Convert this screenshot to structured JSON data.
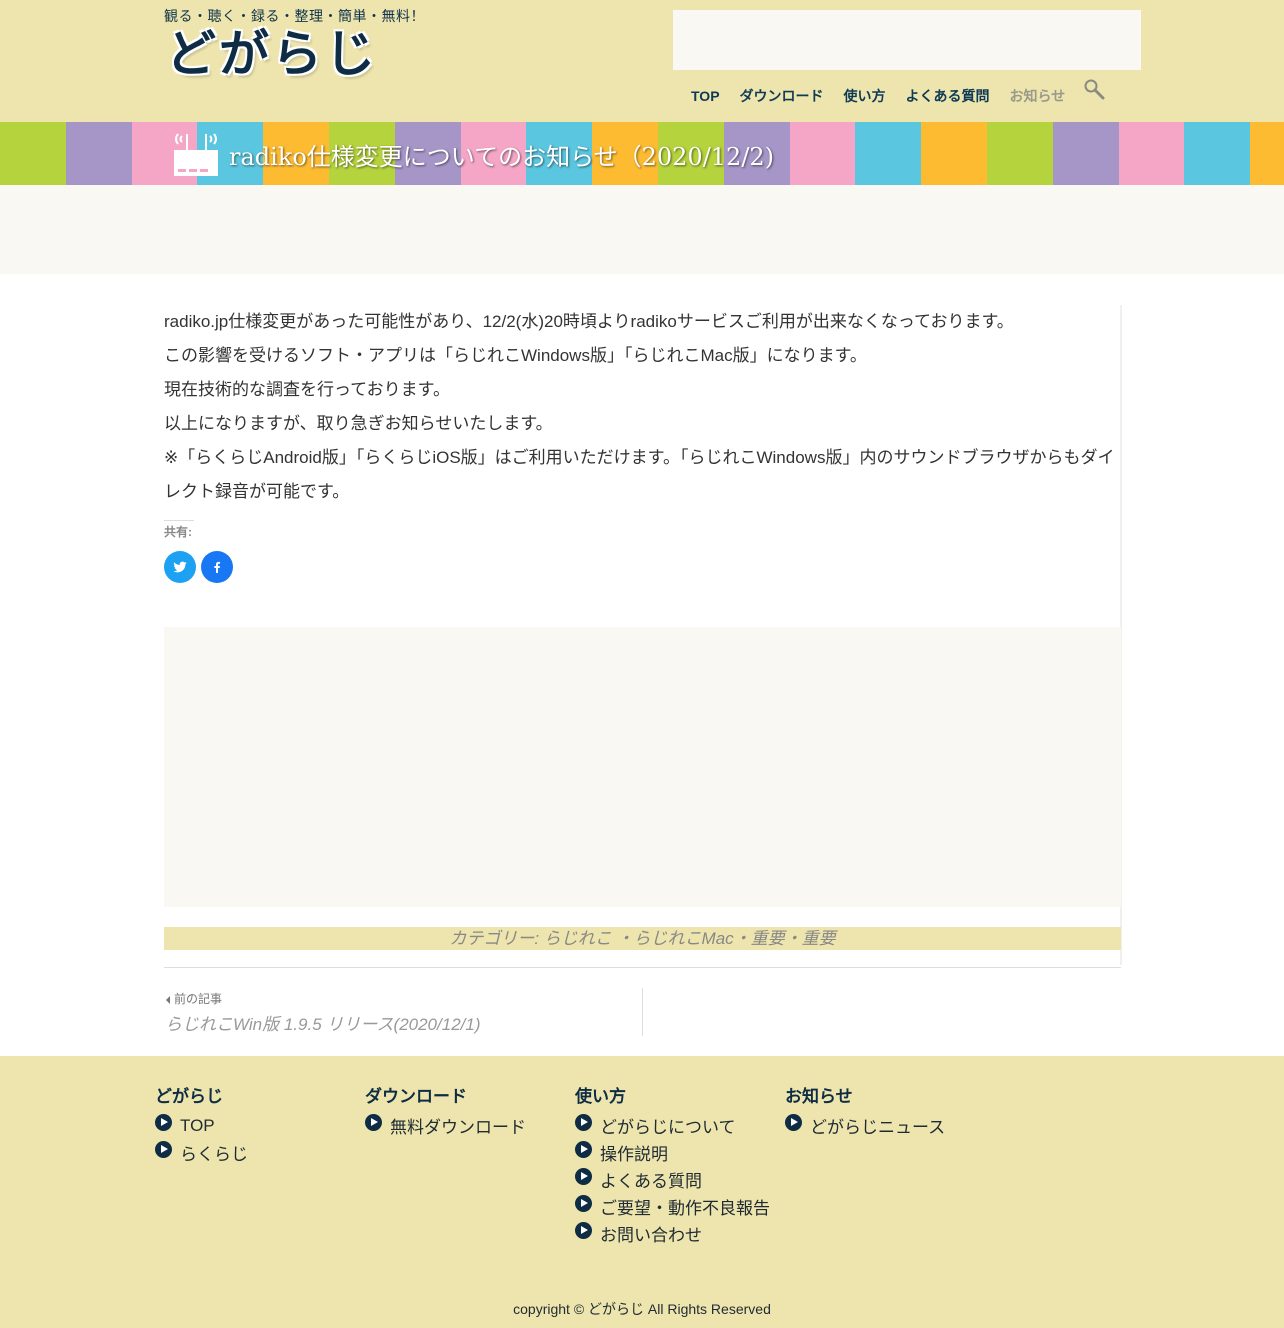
{
  "header": {
    "tagline": "観る・聴く・録る・整理・簡単・無料！",
    "logo_text": "どがらじ",
    "nav": [
      {
        "label": "TOP"
      },
      {
        "label": "ダウンロード"
      },
      {
        "label": "使い方"
      },
      {
        "label": "よくある質問"
      },
      {
        "label": "お知らせ"
      }
    ],
    "search_icon": "search-icon"
  },
  "banner": {
    "title": "radiko仕様変更についてのお知らせ（2020/12/2)",
    "icon": "radio-router-icon",
    "stripe_colors": [
      "#b5d33d",
      "#a696c8",
      "#f5a6c7",
      "#5bc6e0",
      "#fdbb32",
      "#b5d33d",
      "#a696c8",
      "#f5a6c7",
      "#5bc6e0",
      "#fdbb32",
      "#b5d33d",
      "#a696c8",
      "#f5a6c7",
      "#5bc6e0",
      "#fdbb32",
      "#b5d33d",
      "#a696c8",
      "#f5a6c7",
      "#5bc6e0",
      "#fdbb32"
    ]
  },
  "article": {
    "paragraphs": [
      "radiko.jp仕様変更があった可能性があり、12/2(水)20時頃よりradikoサービスご利用が出来なくなっております。",
      "この影響を受けるソフト・アプリは「らじれこWindows版」「らじれこMac版」になります。",
      "現在技術的な調査を行っております。",
      "以上になりますが、取り急ぎお知らせいたします。",
      "※「らくらじAndroid版」「らくらじiOS版」はご利用いただけます。「らじれこWindows版」内のサウンドブラウザからもダイレクト録音が可能です。"
    ],
    "share_label": "共有:"
  },
  "category": {
    "prefix": "カテゴリー:",
    "items": [
      "らじれこ",
      "らじれこMac",
      "重要",
      "重要"
    ]
  },
  "post_nav": {
    "prev_label": "前の記事",
    "prev_title": "らじれこWin版 1.9.5 リリース(2020/12/1)"
  },
  "footer": {
    "columns": [
      {
        "title": "どがらじ",
        "items": [
          "TOP",
          "らくらじ"
        ]
      },
      {
        "title": "ダウンロード",
        "items": [
          "無料ダウンロード"
        ]
      },
      {
        "title": "使い方",
        "items": [
          "どがらじについて",
          "操作説明",
          "よくある質問",
          "ご要望・動作不良報告",
          "お問い合わせ"
        ]
      },
      {
        "title": "お知らせ",
        "items": [
          "どがらじニュース"
        ]
      }
    ],
    "copyright": "copyright © どがらじ All Rights Reserved"
  },
  "colors": {
    "header_bg": "#ede5ad",
    "nav_text": "#0e3a56",
    "ad_bg": "#faf8f3",
    "twitter": "#1da1f2",
    "facebook": "#1877f2"
  }
}
